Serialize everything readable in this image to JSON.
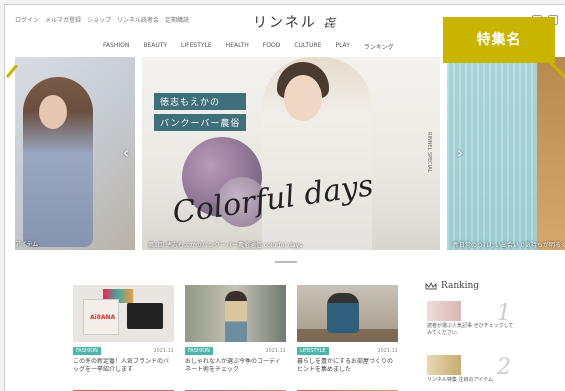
{
  "header": {
    "top_links": [
      "ログイン",
      "メルマガ登録",
      "ショップ",
      "リンネル読者会",
      "定期購読"
    ],
    "logo": "リンネル",
    "logo_mark": "㐂",
    "nav": [
      "FASHION",
      "BEAUTY",
      "LIFESTYLE",
      "HEALTH",
      "FOOD",
      "CULTURE",
      "PLAY",
      "ランキング"
    ]
  },
  "badge": {
    "label": "特集名",
    "color": "#c9b400"
  },
  "carousel": {
    "left_caption": "アイテム",
    "main": {
      "title_lines": [
        "徳志もえかの",
        "バンクーバー農俗"
      ],
      "script": "Colorful days",
      "side_tag": "RINNEL SPECIAL",
      "caption": "第1回 徳志もえかのバンクーバー農俗通信 colorful days"
    },
    "right_caption": "新日常のうれしい出会いで気持ちが明るく",
    "prev_label": "‹",
    "next_label": "›"
  },
  "articles": [
    {
      "tag": "FASHION",
      "date": "2021.11",
      "title": "この冬の新定番！人気ブランドのバッグを一挙紹介します",
      "logo_text": "Ai8ANA"
    },
    {
      "tag": "FASHION",
      "date": "2021.11",
      "title": "おしゃれな人が選ぶ今季のコーディネート術をチェック",
      "logo_text": ""
    },
    {
      "tag": "LIFESTYLE",
      "date": "2021.11",
      "title": "暮らしを豊かにするお部屋づくりのヒントを集めました",
      "logo_text": ""
    }
  ],
  "ranking": {
    "heading": "Ranking",
    "items": [
      {
        "rank": "1",
        "title": "読者が選ぶ人気記事 ぜひチェックしてみてください"
      },
      {
        "rank": "2",
        "title": "リンネル特集 注目のアイテム"
      }
    ]
  },
  "colors": {
    "tag": "#4db6ac",
    "title_band": "#3f6f78",
    "badge": "#c9b400"
  }
}
